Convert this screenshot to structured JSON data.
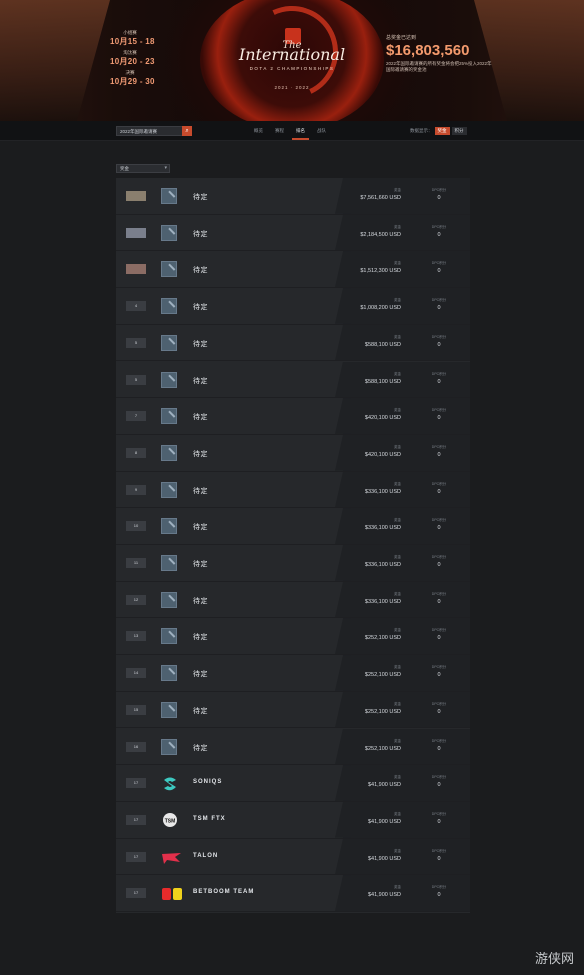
{
  "hero": {
    "dates": [
      {
        "label": "小组赛",
        "value": "10月15 - 18"
      },
      {
        "label": "淘汰赛",
        "value": "10月20 - 23"
      },
      {
        "label": "决赛",
        "value": "10月29 - 30"
      }
    ],
    "logo_the": "The",
    "logo_title": "International",
    "logo_sub": "DOTA 2 CHAMPIONSHIPS",
    "logo_years": "2021 · 2022",
    "prize_label": "总奖金已达到",
    "prize_amount": "$16,803,560",
    "prize_desc": "2022年国际邀请赛的所有奖金将会把25%投入2022年国际邀请赛的奖金池"
  },
  "nav": {
    "season_select": "2022年国际邀请赛",
    "tabs": [
      "概览",
      "赛程",
      "排名",
      "战队"
    ],
    "active_tab_index": 2,
    "sort_label": "数据显示：",
    "sort_options": [
      "奖金",
      "积分"
    ],
    "sort_active_index": 0
  },
  "filter": {
    "label": "奖金"
  },
  "columns": {
    "prize_label": "奖金",
    "points_label": "DPC积分"
  },
  "rows": [
    {
      "rank": "",
      "rank_style": "gold",
      "team": "待定",
      "logo": "tbd",
      "prize": "$7,561,660 USD",
      "points": "0"
    },
    {
      "rank": "",
      "rank_style": "silver",
      "team": "待定",
      "logo": "tbd",
      "prize": "$2,184,500 USD",
      "points": "0"
    },
    {
      "rank": "",
      "rank_style": "bronze",
      "team": "待定",
      "logo": "tbd",
      "prize": "$1,512,300 USD",
      "points": "0"
    },
    {
      "rank": "4",
      "rank_style": "",
      "team": "待定",
      "logo": "tbd",
      "prize": "$1,008,200 USD",
      "points": "0"
    },
    {
      "rank": "5",
      "rank_style": "",
      "team": "待定",
      "logo": "tbd",
      "prize": "$588,100 USD",
      "points": "0"
    },
    {
      "rank": "5",
      "rank_style": "",
      "team": "待定",
      "logo": "tbd",
      "prize": "$588,100 USD",
      "points": "0"
    },
    {
      "rank": "7",
      "rank_style": "",
      "team": "待定",
      "logo": "tbd",
      "prize": "$420,100 USD",
      "points": "0"
    },
    {
      "rank": "8",
      "rank_style": "",
      "team": "待定",
      "logo": "tbd",
      "prize": "$420,100 USD",
      "points": "0"
    },
    {
      "rank": "9",
      "rank_style": "",
      "team": "待定",
      "logo": "tbd",
      "prize": "$336,100 USD",
      "points": "0"
    },
    {
      "rank": "10",
      "rank_style": "",
      "team": "待定",
      "logo": "tbd",
      "prize": "$336,100 USD",
      "points": "0"
    },
    {
      "rank": "11",
      "rank_style": "",
      "team": "待定",
      "logo": "tbd",
      "prize": "$336,100 USD",
      "points": "0"
    },
    {
      "rank": "12",
      "rank_style": "",
      "team": "待定",
      "logo": "tbd",
      "prize": "$336,100 USD",
      "points": "0"
    },
    {
      "rank": "13",
      "rank_style": "",
      "team": "待定",
      "logo": "tbd",
      "prize": "$252,100 USD",
      "points": "0"
    },
    {
      "rank": "14",
      "rank_style": "",
      "team": "待定",
      "logo": "tbd",
      "prize": "$252,100 USD",
      "points": "0"
    },
    {
      "rank": "15",
      "rank_style": "",
      "team": "待定",
      "logo": "tbd",
      "prize": "$252,100 USD",
      "points": "0"
    },
    {
      "rank": "16",
      "rank_style": "",
      "team": "待定",
      "logo": "tbd",
      "prize": "$252,100 USD",
      "points": "0"
    },
    {
      "rank": "17",
      "rank_style": "",
      "team": "SONIQS",
      "logo": "soniqs",
      "prize": "$41,900 USD",
      "points": "0"
    },
    {
      "rank": "17",
      "rank_style": "",
      "team": "TSM FTX",
      "logo": "tsm",
      "prize": "$41,900 USD",
      "points": "0"
    },
    {
      "rank": "17",
      "rank_style": "",
      "team": "TALON",
      "logo": "talon",
      "prize": "$41,900 USD",
      "points": "0"
    },
    {
      "rank": "17",
      "rank_style": "",
      "team": "BETBOOM TEAM",
      "logo": "bb",
      "prize": "$41,900 USD",
      "points": "0"
    }
  ],
  "watermark": "游侠网",
  "colors": {
    "accent": "#c74b2d",
    "prize_text": "#f39a6d"
  }
}
